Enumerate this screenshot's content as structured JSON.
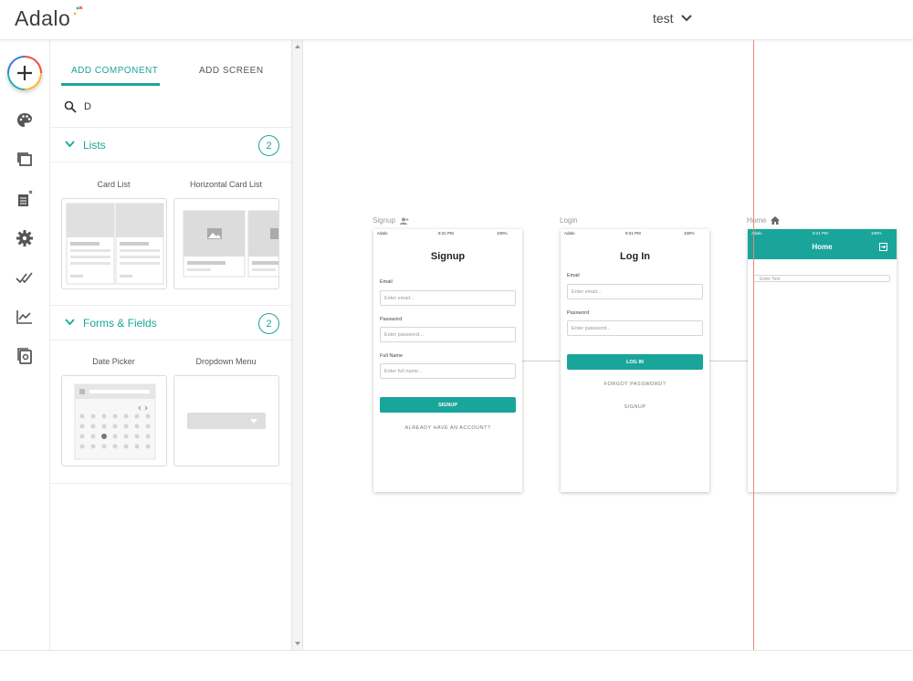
{
  "app": {
    "logo_text": "Adalo",
    "project_name": "test",
    "accent_color": "#1aa59a",
    "guide_color": "#e8887a"
  },
  "rail": {
    "items": [
      {
        "icon": "plus-icon"
      },
      {
        "icon": "palette-icon"
      },
      {
        "icon": "screens-icon"
      },
      {
        "icon": "database-icon"
      },
      {
        "icon": "gear-icon"
      },
      {
        "icon": "publish-check-icon"
      },
      {
        "icon": "analytics-icon"
      },
      {
        "icon": "marketplace-icon"
      }
    ]
  },
  "panel": {
    "tabs": [
      {
        "label": "ADD COMPONENT",
        "active": true
      },
      {
        "label": "ADD SCREEN",
        "active": false
      }
    ],
    "search": {
      "value": "D",
      "placeholder": ""
    },
    "sections": [
      {
        "title": "Lists",
        "count": "2",
        "components": [
          {
            "label": "Card List"
          },
          {
            "label": "Horizontal Card List"
          }
        ]
      },
      {
        "title": "Forms & Fields",
        "count": "2",
        "components": [
          {
            "label": "Date Picker"
          },
          {
            "label": "Dropdown Menu"
          }
        ]
      }
    ]
  },
  "canvas": {
    "screens": [
      {
        "name": "Signup",
        "status": {
          "carrier": "Adalo",
          "time": "9:21 PM",
          "battery": "100%"
        },
        "title": "Signup",
        "fields": [
          {
            "label": "Email",
            "placeholder": "Enter email..."
          },
          {
            "label": "Password",
            "placeholder": "Enter password..."
          },
          {
            "label": "Full Name",
            "placeholder": "Enter full name..."
          }
        ],
        "button": "SIGNUP",
        "links": [
          "ALREADY HAVE AN ACCOUNT?"
        ]
      },
      {
        "name": "Login",
        "status": {
          "carrier": "Adalo",
          "time": "9:21 PM",
          "battery": "100%"
        },
        "title": "Log In",
        "fields": [
          {
            "label": "Email",
            "placeholder": "Enter email..."
          },
          {
            "label": "Password",
            "placeholder": "Enter password..."
          }
        ],
        "button": "LOG IN",
        "links": [
          "FORGOT PASSWORD?",
          "SIGNUP"
        ]
      },
      {
        "name": "Home",
        "status": {
          "carrier": "Adalo",
          "time": "9:21 PM",
          "battery": "100%"
        },
        "title": "Home",
        "input_placeholder": "Enter Text"
      }
    ]
  }
}
